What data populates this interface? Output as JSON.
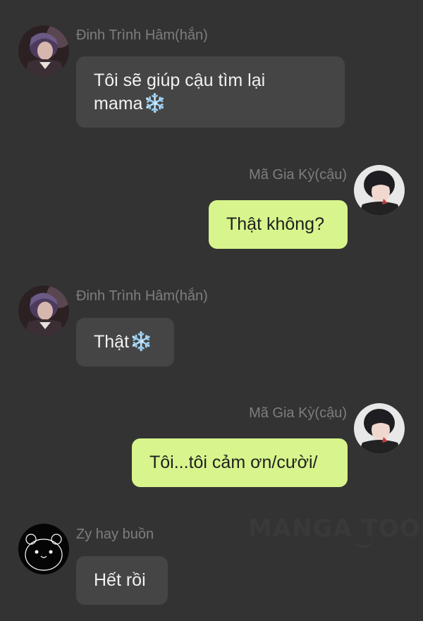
{
  "messages": [
    {
      "sender": "Đinh Trình Hâm(hắn)",
      "side": "them",
      "avatar_icon": "dark-haired-boy-avatar",
      "text": "Tôi sẽ giúp cậu tìm lại\nmama",
      "emoji": "❄️"
    },
    {
      "sender": "Mã Gia Kỳ(cậu)",
      "side": "me",
      "avatar_icon": "boy-avatar",
      "text": "Thật không?",
      "emoji": ""
    },
    {
      "sender": "Đinh Trình Hâm(hắn)",
      "side": "them",
      "avatar_icon": "dark-haired-boy-avatar",
      "text": "Thật",
      "emoji": "❄️"
    },
    {
      "sender": "Mã Gia Kỳ(cậu)",
      "side": "me",
      "avatar_icon": "boy-avatar",
      "text": "Tôi...tôi cảm ơn/cười/",
      "emoji": ""
    },
    {
      "sender": "Zy hay buồn",
      "side": "them",
      "avatar_icon": "black-bear-avatar",
      "text": "Hết rồi",
      "emoji": ""
    }
  ],
  "watermark": "MANGA TOON",
  "colors": {
    "background": "#333333",
    "incoming_bubble": "#454545",
    "outgoing_bubble": "#d7f58c",
    "sender_name": "#7e7e7e"
  }
}
